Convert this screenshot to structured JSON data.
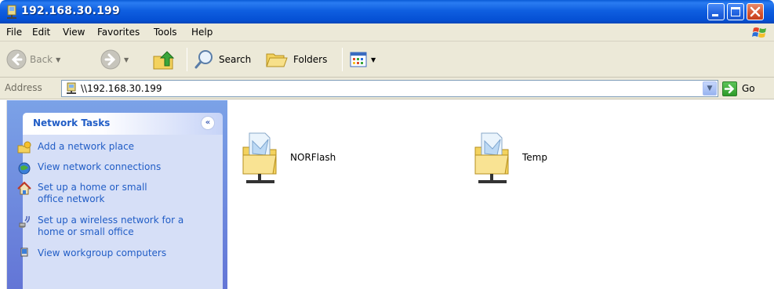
{
  "window": {
    "title": "192.168.30.199",
    "icon": "network-share-icon",
    "controls": [
      "minimize-icon",
      "maximize-icon",
      "close-icon"
    ]
  },
  "menu": {
    "items": [
      "File",
      "Edit",
      "View",
      "Favorites",
      "Tools",
      "Help"
    ]
  },
  "toolbar": {
    "back_label": "Back",
    "search_label": "Search",
    "folders_label": "Folders"
  },
  "address": {
    "label": "Address",
    "value": "\\\\192.168.30.199",
    "go_label": "Go"
  },
  "tasks": {
    "title": "Network Tasks",
    "items": [
      {
        "label": "Add a network place",
        "icon": "add-network-place-icon"
      },
      {
        "label": "View network connections",
        "icon": "network-connections-icon"
      },
      {
        "label": "Set up a home or small office network",
        "icon": "home-network-icon"
      },
      {
        "label": "Set up a wireless network for a home or small office",
        "icon": "wireless-network-icon"
      },
      {
        "label": "View workgroup computers",
        "icon": "workgroup-computers-icon"
      }
    ]
  },
  "shares": [
    {
      "name": "NORFlash"
    },
    {
      "name": "Temp"
    }
  ],
  "colors": {
    "title_blue": "#0550d4",
    "chrome": "#ece9d8",
    "task_blue": "#215dc6",
    "pane_gradient_top": "#7ba2e7"
  }
}
